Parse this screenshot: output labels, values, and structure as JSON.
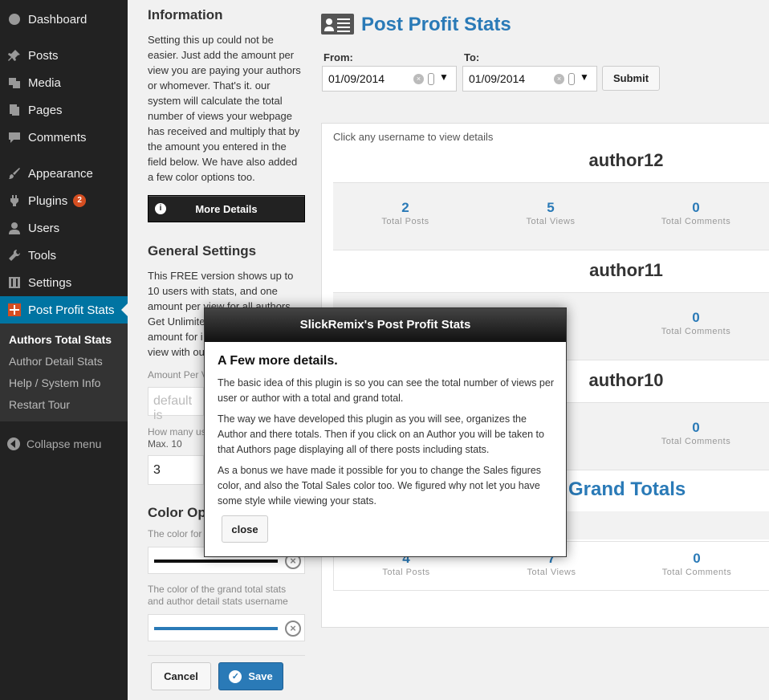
{
  "sidebar": {
    "menu": [
      {
        "label": "Dashboard",
        "icon": "dashboard-icon"
      },
      {
        "label": "Posts",
        "icon": "pin-icon"
      },
      {
        "label": "Media",
        "icon": "media-icon"
      },
      {
        "label": "Pages",
        "icon": "pages-icon"
      },
      {
        "label": "Comments",
        "icon": "comment-icon"
      },
      {
        "label": "Appearance",
        "icon": "brush-icon"
      },
      {
        "label": "Plugins",
        "icon": "plug-icon",
        "badge": "2"
      },
      {
        "label": "Users",
        "icon": "user-icon"
      },
      {
        "label": "Tools",
        "icon": "wrench-icon"
      },
      {
        "label": "Settings",
        "icon": "sliders-icon"
      },
      {
        "label": "Post Profit Stats",
        "icon": "stats-plugin-icon"
      }
    ],
    "submenu": [
      "Authors Total Stats",
      "Author Detail Stats",
      "Help / System Info",
      "Restart Tour"
    ],
    "collapse_label": "Collapse menu"
  },
  "settings": {
    "info_title": "Information",
    "info_text_lines": [
      "Setting this up could not be",
      "easier. Just add the amount per",
      "view you are paying your authors",
      "or whomever. That's it. our",
      "system will calculate the total",
      "number of views your webpage",
      "has received and multiply that by",
      "the amount you entered in the",
      "field below. We have also added",
      "a few color options too."
    ],
    "more_details_label": "More Details",
    "general_title": "General Settings",
    "general_text_lines": [
      "This FREE version shows up to",
      "10 users with stats, and one",
      "amount per view for all authors.",
      "Get Unlimite",
      "amount for i",
      "view with ou"
    ],
    "amount_label": "Amount Per V",
    "amount_placeholder": "default is",
    "howmany_label_1": "How many us",
    "howmany_label_2": "Max. 10",
    "howmany_value": "3",
    "color_title": "Color Op",
    "color_label_1": "The color for",
    "color_label_2a": "The color of the grand total stats",
    "color_label_2b": "and author detail stats username",
    "color_1": "#111111",
    "color_2": "#2a7ab7",
    "cancel_label": "Cancel",
    "save_label": "Save"
  },
  "stats_page": {
    "title": "Post Profit Stats",
    "from_label": "From:",
    "to_label": "To:",
    "from_date": "01/09/2014",
    "to_date": "01/09/2014",
    "submit_label": "Submit",
    "hint": "Click any username to view details",
    "authors": [
      {
        "name": "author12",
        "posts": "2",
        "views": "5",
        "comments": "0"
      },
      {
        "name": "author11",
        "comments": "0"
      },
      {
        "name": "author10",
        "views_partial": "ws",
        "comments": "0"
      }
    ],
    "labels": {
      "posts": "Total Posts",
      "views": "Total Views",
      "comments": "Total Comments"
    },
    "grand_title": "Grand Totals",
    "grand": {
      "posts": "4",
      "views": "7",
      "comments": "0"
    }
  },
  "modal": {
    "title": "SlickRemix's Post Profit Stats",
    "heading": "A Few more details.",
    "paragraphs": [
      "The basic idea of this plugin is so you can see the total number of views per user or author with a total and grand total.",
      "The way we have developed this plugin as you will see, organizes the Author and there totals. Then if you click on an Author you will be taken to that Authors page displaying all of there posts including stats.",
      "As a bonus we have made it possible for you to change the Sales figures color, and also the Total Sales color too. We figured why not let you have some style while viewing your stats."
    ],
    "close_label": "close"
  }
}
